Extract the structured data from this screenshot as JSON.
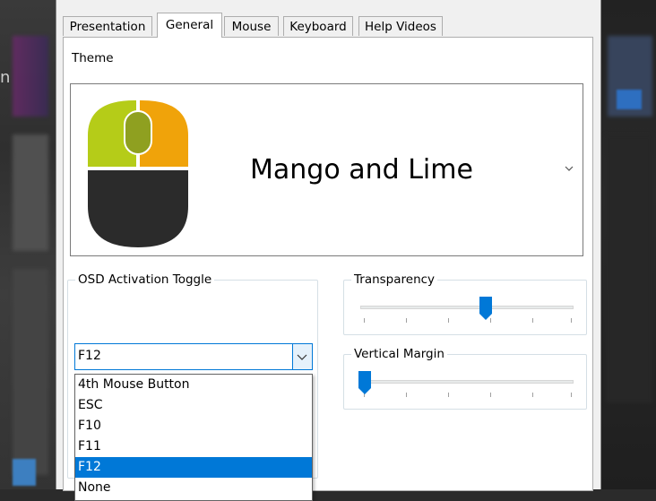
{
  "tabs": [
    {
      "label": "Presentation",
      "active": false
    },
    {
      "label": "General",
      "active": true
    },
    {
      "label": "Mouse",
      "active": false
    },
    {
      "label": "Keyboard",
      "active": false
    },
    {
      "label": "Help Videos",
      "active": false
    }
  ],
  "theme": {
    "group_title": "Theme",
    "selected": "Mango and Lime",
    "colors": {
      "lime": "#b5cc18",
      "lime_dark": "#8fa020",
      "mango": "#f0a30a",
      "body": "#2b2b2b"
    }
  },
  "osd": {
    "group_title": "OSD Activation Toggle",
    "selected": "F12",
    "options": [
      "4th Mouse Button",
      "ESC",
      "F10",
      "F11",
      "F12",
      "None"
    ],
    "highlighted_index": 4
  },
  "transparency": {
    "label": "Transparency",
    "value_fraction": 0.64
  },
  "vertical_margin": {
    "label": "Vertical Margin",
    "value_fraction": 0.0
  },
  "accent": "#0078d7",
  "background_app": {
    "letter": "n"
  }
}
